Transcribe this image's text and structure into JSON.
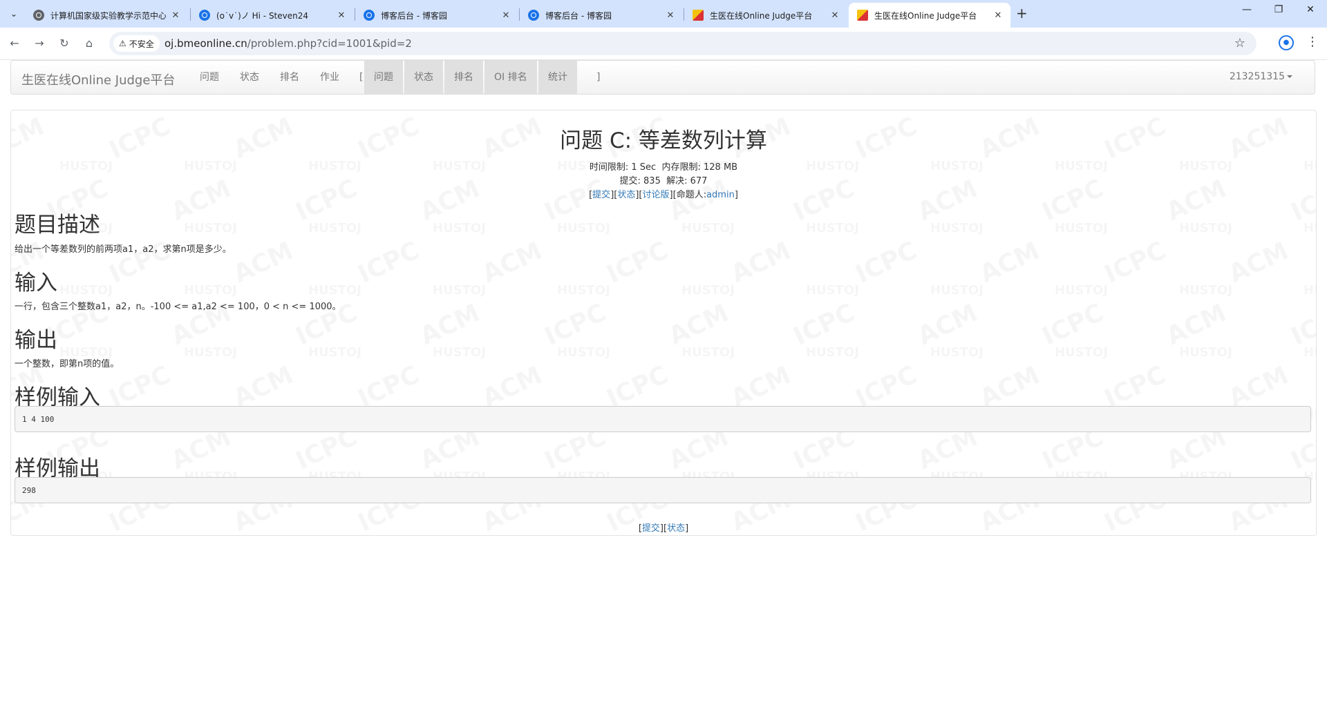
{
  "browser": {
    "tabs": [
      {
        "title": "计算机国家级实验教学示范中心",
        "favicon": "globe-icon",
        "active": false
      },
      {
        "title": "(o˙v˙)ノ Hi - Steven24",
        "favicon": "cnblogs-icon",
        "active": false
      },
      {
        "title": "博客后台 - 博客园",
        "favicon": "cnblogs-icon",
        "active": false
      },
      {
        "title": "博客后台 - 博客园",
        "favicon": "cnblogs-icon",
        "active": false
      },
      {
        "title": "生医在线Online Judge平台",
        "favicon": "oj-icon",
        "active": false
      },
      {
        "title": "生医在线Online Judge平台",
        "favicon": "oj-icon",
        "active": true
      }
    ],
    "security_label": "不安全",
    "url_host": "oj.bmeonline.cn",
    "url_path": "/problem.php?cid=1001&pid=2"
  },
  "site_nav": {
    "brand": "生医在线Online Judge平台",
    "links": [
      "问题",
      "状态",
      "排名",
      "作业"
    ],
    "bracket_open": "[",
    "contest_links": [
      "问题",
      "状态",
      "排名",
      "OI 排名",
      "统计"
    ],
    "bracket_close": "]",
    "user": "213251315"
  },
  "problem": {
    "title": "问题 C: 等差数列计算",
    "time_limit_label": "时间限制: ",
    "time_limit": "1 Sec",
    "memory_limit_label": "内存限制: ",
    "memory_limit": "128 MB",
    "submit_label": "提交: ",
    "submit_count": "835",
    "solved_label": "解决: ",
    "solved_count": "677",
    "link_submit": "提交",
    "link_status": "状态",
    "link_discuss": "讨论版",
    "setter_label": "命题人:",
    "setter": "admin",
    "description_heading": "题目描述",
    "description": "给出一个等差数列的前两项a1，a2，求第n项是多少。",
    "input_heading": "输入",
    "input": "一行，包含三个整数a1，a2，n。-100 <= a1,a2 <= 100，0 < n <= 1000。",
    "output_heading": "输出",
    "output": "一个整数，即第n项的值。",
    "sample_input_heading": "样例输入",
    "sample_input": "1 4 100",
    "sample_output_heading": "样例输出",
    "sample_output": "298"
  }
}
